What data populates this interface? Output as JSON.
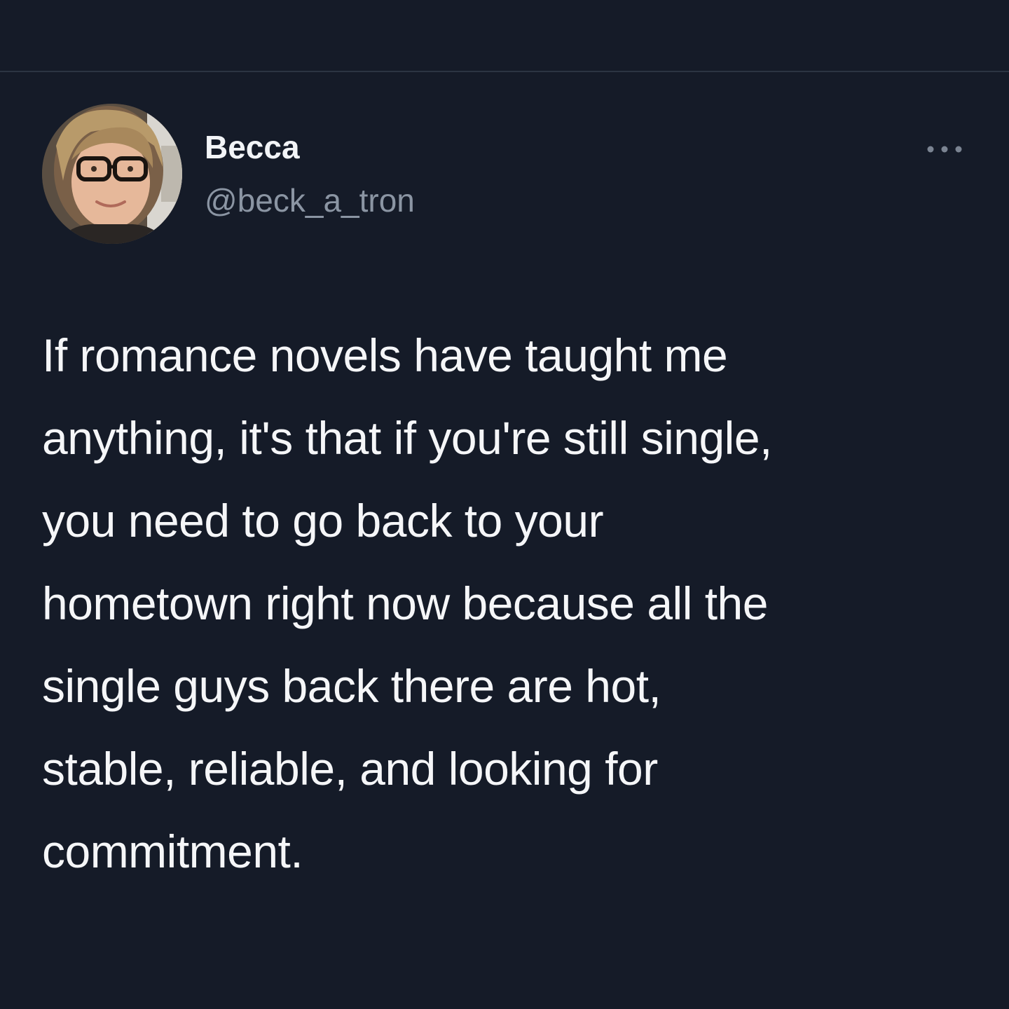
{
  "tweet": {
    "author": {
      "display_name": "Becca",
      "handle": "@beck_a_tron"
    },
    "more_icon": "more-horizontal-icon",
    "text_lines": [
      "If romance novels have taught me",
      "anything, it's that if you're still single,",
      "you need to go back to your",
      "hometown right now because all the",
      "single guys back there are hot,",
      "stable, reliable, and looking for",
      "commitment."
    ]
  },
  "colors": {
    "background": "#151b28",
    "divider": "#2c3442",
    "text_primary": "#f5f6f8",
    "text_secondary": "#8b95a3"
  }
}
